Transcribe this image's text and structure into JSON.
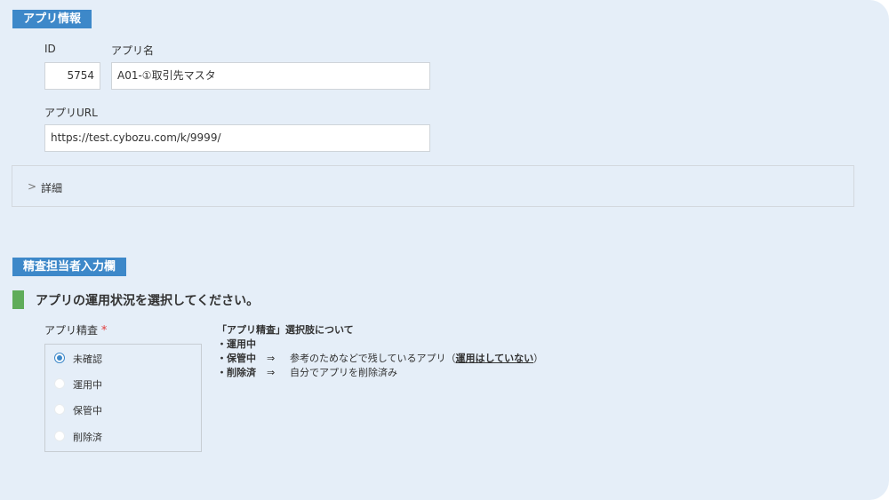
{
  "app_info": {
    "section_title": "アプリ情報",
    "id_label": "ID",
    "id_value": "5754",
    "name_label": "アプリ名",
    "name_value": "A01-①取引先マスタ",
    "url_label": "アプリURL",
    "url_value": "https://test.cybozu.com/k/9999/",
    "details_label": "詳細"
  },
  "reviewer": {
    "section_title": "精査担当者入力欄",
    "question": "アプリの運用状況を選択してください。",
    "field_label": "アプリ精査",
    "required_mark": "*",
    "options": [
      "未確認",
      "運用中",
      "保管中",
      "削除済"
    ],
    "selected": "未確認"
  },
  "note": {
    "title": "「アプリ精査」選択肢について",
    "items": [
      {
        "key": "・運用中",
        "arrow": "",
        "desc": "",
        "emph": "",
        "tail": ""
      },
      {
        "key": "・保管中",
        "arrow": "⇒",
        "desc": "参考のためなどで残しているアプリ（",
        "emph": "運用はしていない",
        "tail": "）"
      },
      {
        "key": "・削除済",
        "arrow": "⇒",
        "desc": "自分でアプリを削除済み",
        "emph": "",
        "tail": ""
      }
    ]
  },
  "colors": {
    "panel_bg": "#e5eef8",
    "section_label_bg": "#3d88c9",
    "accent_green": "#5fac5a",
    "required_red": "#e23b3b"
  }
}
